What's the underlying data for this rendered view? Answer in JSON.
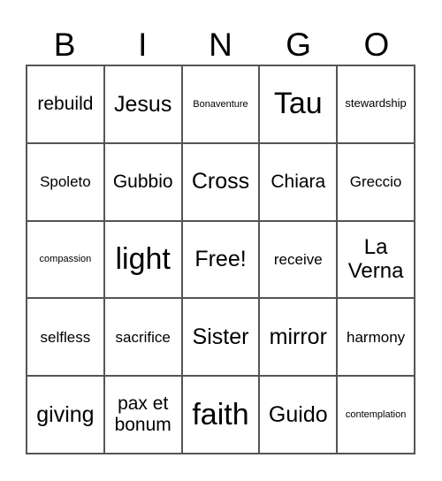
{
  "header": [
    "B",
    "I",
    "N",
    "G",
    "O"
  ],
  "cells": [
    [
      "rebuild",
      "Jesus",
      "Bonaventure",
      "Tau",
      "stewardship"
    ],
    [
      "Spoleto",
      "Gubbio",
      "Cross",
      "Chiara",
      "Greccio"
    ],
    [
      "compassion",
      "light",
      "Free!",
      "receive",
      "La Verna"
    ],
    [
      "selfless",
      "sacrifice",
      "Sister",
      "mirror",
      "harmony"
    ],
    [
      "giving",
      "pax et bonum",
      "faith",
      "Guido",
      "contemplation"
    ]
  ]
}
